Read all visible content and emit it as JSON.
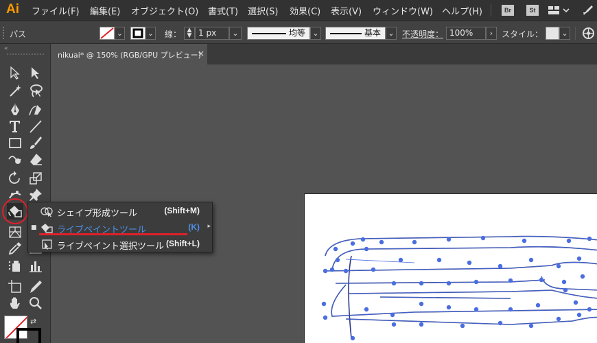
{
  "app": {
    "logo": "Ai"
  },
  "menu": [
    "ファイル(F)",
    "編集(E)",
    "オブジェクト(O)",
    "書式(T)",
    "選択(S)",
    "効果(C)",
    "表示(V)",
    "ウィンドウ(W)",
    "ヘルプ(H)"
  ],
  "menu_right": {
    "br": "Br",
    "st": "St"
  },
  "control": {
    "selection_label": "パス",
    "stroke_label": "線：",
    "stroke_weight": "1 px",
    "profile_label": "均等",
    "brush_label": "基本",
    "opacity_label": "不透明度：",
    "opacity_value": "100%",
    "style_label": "スタイル："
  },
  "document": {
    "tab_title": "nikuai* @ 150% (RGB/GPU プレビュー)",
    "close": "×"
  },
  "flyout": {
    "items": [
      {
        "label": "シェイプ形成ツール",
        "shortcut": "(Shift+M)",
        "selected": false
      },
      {
        "label": "ライブペイントツール",
        "shortcut": "(K)",
        "selected": true
      },
      {
        "label": "ライブペイント選択ツール",
        "shortcut": "(Shift+L)",
        "selected": false
      }
    ]
  },
  "colors": {
    "highlight": "#4d8fe6",
    "annotation": "#e0202a",
    "path": "#4a6ee0"
  }
}
